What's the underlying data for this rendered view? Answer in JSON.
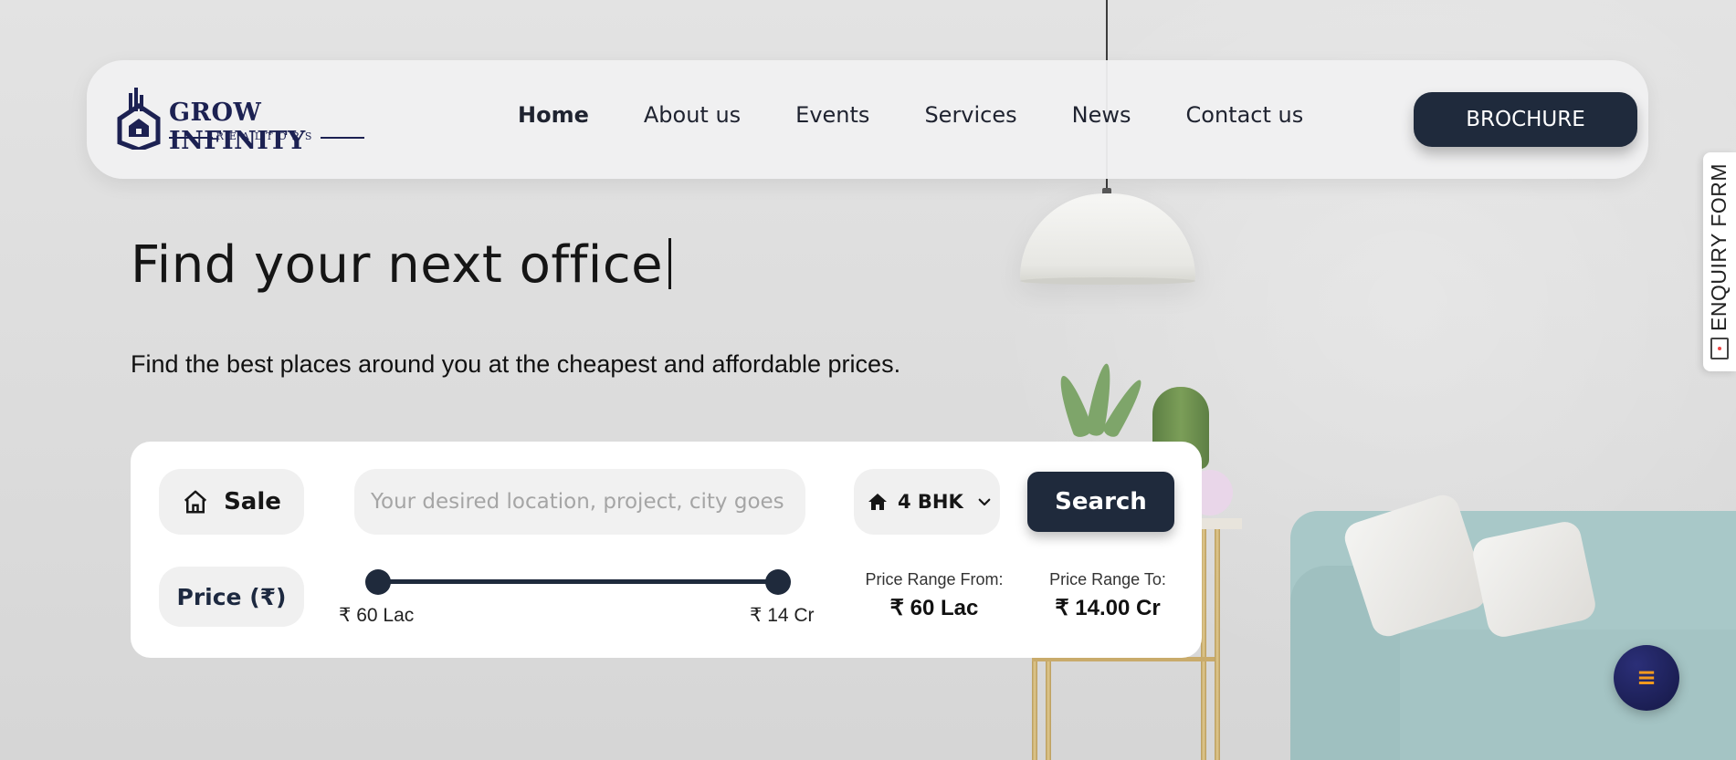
{
  "brand": {
    "name": "GROW INFINITY",
    "tagline": "REALTORS"
  },
  "nav": {
    "items": [
      {
        "label": "Home",
        "active": true
      },
      {
        "label": "About us",
        "active": false
      },
      {
        "label": "Events",
        "active": false
      },
      {
        "label": "Services",
        "active": false
      },
      {
        "label": "News",
        "active": false
      },
      {
        "label": "Contact us",
        "active": false
      }
    ],
    "brochure_label": "BROCHURE"
  },
  "hero": {
    "title": "Find your next office",
    "subtitle": "Find the best places around you at the cheapest and affordable prices."
  },
  "search": {
    "listing_type": "Sale",
    "location_placeholder": "Your desired location, project, city goes here",
    "bhk": "4 BHK",
    "search_label": "Search",
    "price_label": "Price (₹)",
    "slider_min_label": "₹ 60 Lac",
    "slider_max_label": "₹ 14 Cr",
    "slider_low_fraction": 0.0,
    "slider_high_fraction": 1.0,
    "range_from_label": "Price Range From:",
    "range_from_value": "₹ 60 Lac",
    "range_to_label": "Price Range To:",
    "range_to_value": "₹ 14.00 Cr"
  },
  "enquiry": {
    "label": "ENQUIRY FORM"
  },
  "fab": {
    "icon": "menu-icon",
    "color": "#f39a1e"
  },
  "colors": {
    "primary": "#1f2a3c",
    "brand": "#1c2152"
  }
}
